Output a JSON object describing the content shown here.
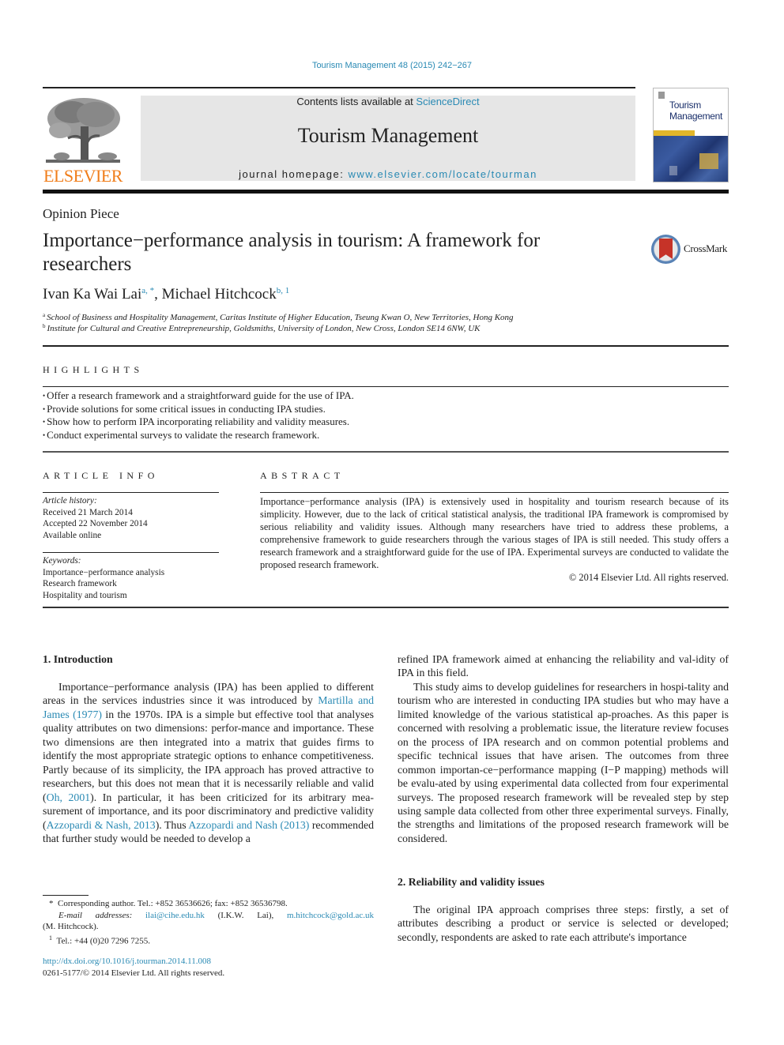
{
  "journal_ref": "Tourism Management 48 (2015) 242−267",
  "masthead": {
    "contents_prefix": "Contents lists available at ",
    "contents_link": "ScienceDirect",
    "journal_name": "Tourism Management",
    "homepage_prefix": "journal homepage: ",
    "homepage_link": "www.elsevier.com/locate/tourman",
    "publisher_logo": "ELSEVIER",
    "cover_title_line1": "Tourism",
    "cover_title_line2": "Management"
  },
  "colors": {
    "link": "#2a8ab4",
    "elsevier_orange": "#f07d1a",
    "masthead_bg": "#e6e6e6"
  },
  "article": {
    "type": "Opinion Piece",
    "title": "Importance−performance analysis in tourism: A framework for researchers",
    "crossmark_label": "CrossMark",
    "authors": [
      {
        "name": "Ivan Ka Wai Lai",
        "sup": "a, *"
      },
      {
        "name": "Michael Hitchcock",
        "sup": "b, 1"
      }
    ],
    "author_separator": ", ",
    "affiliations": [
      {
        "mark": "a",
        "text": "School of Business and Hospitality Management, Caritas Institute of Higher Education, Tseung Kwan O, New Territories, Hong Kong"
      },
      {
        "mark": "b",
        "text": "Institute for Cultural and Creative Entrepreneurship, Goldsmiths, University of London, New Cross, London SE14 6NW, UK"
      }
    ]
  },
  "highlights": {
    "heading": "HIGHLIGHTS",
    "bullet": "•",
    "items": [
      "Offer a research framework and a straightforward guide for the use of IPA.",
      "Provide solutions for some critical issues in conducting IPA studies.",
      "Show how to perform IPA incorporating reliability and validity measures.",
      "Conduct experimental surveys to validate the research framework."
    ]
  },
  "article_info": {
    "heading": "ARTICLE INFO",
    "history_label": "Article history:",
    "history": [
      "Received 21 March 2014",
      "Accepted 22 November 2014",
      "Available online"
    ],
    "keywords_label": "Keywords:",
    "keywords": [
      "Importance−performance analysis",
      "Research framework",
      "Hospitality and tourism"
    ]
  },
  "abstract": {
    "heading": "ABSTRACT",
    "text": "Importance−performance analysis (IPA) is extensively used in hospitality and tourism research because of its simplicity. However, due to the lack of critical statistical analysis, the traditional IPA framework is compromised by serious reliability and validity issues. Although many researchers have tried to address these problems, a comprehensive framework to guide researchers through the various stages of IPA is still needed. This study offers a research framework and a straightforward guide for the use of IPA. Experimental surveys are conducted to validate the proposed research framework.",
    "copyright": "© 2014 Elsevier Ltd. All rights reserved."
  },
  "body": {
    "section1_heading": "1.  Introduction",
    "s1p1_a": "Importance−performance analysis (IPA) has been applied to different areas in the services industries since it was introduced by ",
    "s1p1_cite1": "Martilla and James (1977)",
    "s1p1_b": " in the 1970s. IPA is a simple but effective tool that analyses quality attributes on two dimensions: perfor-mance and importance. These two dimensions are then integrated into a matrix that guides firms to identify the most appropriate strategic options to enhance competitiveness. Partly because of its simplicity, the IPA approach has proved attractive to researchers, but this does not mean that it is necessarily reliable and valid (",
    "s1p1_cite2": "Oh, 2001",
    "s1p1_c": "). In particular, it has been criticized for its arbitrary mea-surement of importance, and its poor discriminatory and predictive validity (",
    "s1p1_cite3": "Azzopardi & Nash, 2013",
    "s1p1_d": "). Thus ",
    "s1p1_cite4": "Azzopardi and Nash (2013)",
    "s1p1_e": " recommended that further study would be needed to develop a",
    "col2_p0": "refined IPA framework aimed at enhancing the reliability and val-idity of IPA in this field.",
    "col2_p1": "This study aims to develop guidelines for researchers in hospi-tality and tourism who are interested in conducting IPA studies but who may have a limited knowledge of the various statistical ap-proaches. As this paper is concerned with resolving a problematic issue, the literature review focuses on the process of IPA research and on common potential problems and specific technical issues that have arisen. The outcomes from three common importan-ce−performance mapping (I−P mapping) methods will be evalu-ated by using experimental data collected from four experimental surveys. The proposed research framework will be revealed step by step using sample data collected from other three experimental surveys. Finally, the strengths and limitations of the proposed research framework will be considered.",
    "section2_heading": "2.  Reliability and validity issues",
    "s2p1": "The original IPA approach comprises three steps: firstly, a set of attributes describing a product or service is selected or developed; secondly, respondents are asked to rate each attribute's importance"
  },
  "footnotes": {
    "corr_mark": "*",
    "corr_text": "Corresponding author. Tel.: +852 36536626; fax: +852 36536798.",
    "email_label": "E-mail addresses:",
    "email1": "ilai@cihe.edu.hk",
    "email1_owner": " (I.K.W. Lai), ",
    "email2": "m.hitchcock@gold.ac.uk",
    "email2_owner": "(M. Hitchcock).",
    "fn1_mark": "1",
    "fn1_text": "Tel.: +44 (0)20 7296 7255."
  },
  "doi": "http://dx.doi.org/10.1016/j.tourman.2014.11.008",
  "issn_line": "0261-5177/© 2014 Elsevier Ltd. All rights reserved."
}
